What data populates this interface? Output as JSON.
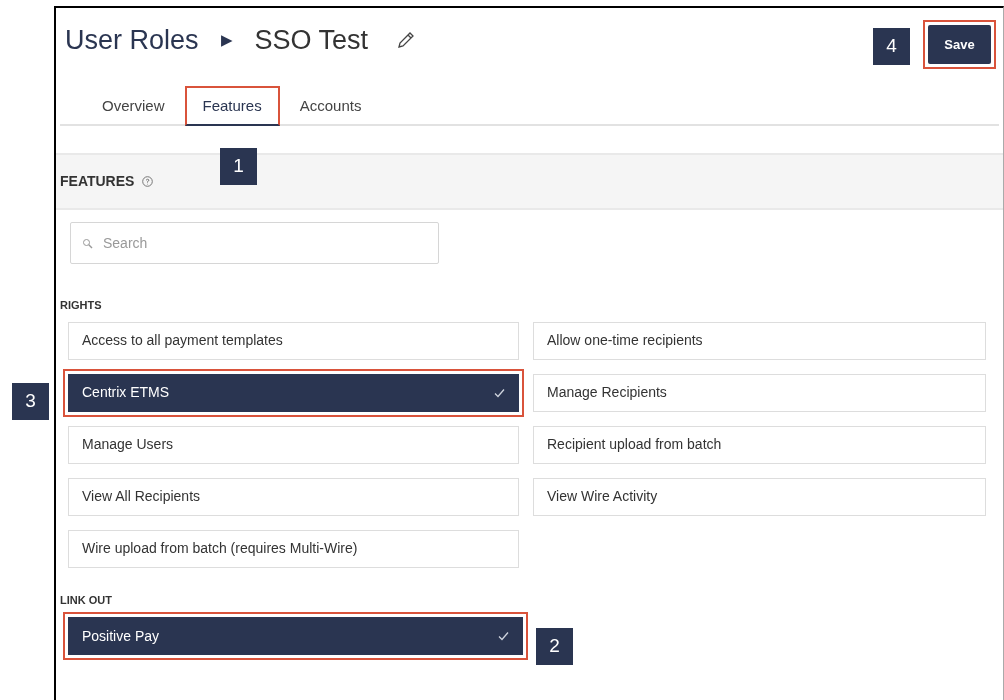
{
  "breadcrumb": {
    "parent": "User Roles",
    "separator": "▶",
    "current": "SSO Test"
  },
  "save_button": {
    "label": "Save",
    "highlighted": true
  },
  "tabs": [
    {
      "label": "Overview",
      "selected": false,
      "highlighted": false
    },
    {
      "label": "Features",
      "selected": true,
      "highlighted": true
    },
    {
      "label": "Accounts",
      "selected": false,
      "highlighted": false
    }
  ],
  "section": {
    "title": "FEATURES"
  },
  "search": {
    "placeholder": "Search"
  },
  "rights": {
    "title": "RIGHTS",
    "items": [
      {
        "label": "Access to all payment templates",
        "checked": false,
        "highlighted": false
      },
      {
        "label": "Allow one-time recipients",
        "checked": false,
        "highlighted": false
      },
      {
        "label": "Centrix ETMS",
        "checked": true,
        "highlighted": true
      },
      {
        "label": "Manage Recipients",
        "checked": false,
        "highlighted": false
      },
      {
        "label": "Manage Users",
        "checked": false,
        "highlighted": false
      },
      {
        "label": "Recipient upload from batch",
        "checked": false,
        "highlighted": false
      },
      {
        "label": "View All Recipients",
        "checked": false,
        "highlighted": false
      },
      {
        "label": "View Wire Activity",
        "checked": false,
        "highlighted": false
      },
      {
        "label": "Wire upload from batch (requires Multi-Wire)",
        "checked": false,
        "highlighted": false
      }
    ]
  },
  "link_out": {
    "title": "LINK OUT",
    "items": [
      {
        "label": "Positive Pay",
        "checked": true,
        "highlighted": true
      }
    ]
  },
  "callouts": [
    "1",
    "2",
    "3",
    "4"
  ]
}
